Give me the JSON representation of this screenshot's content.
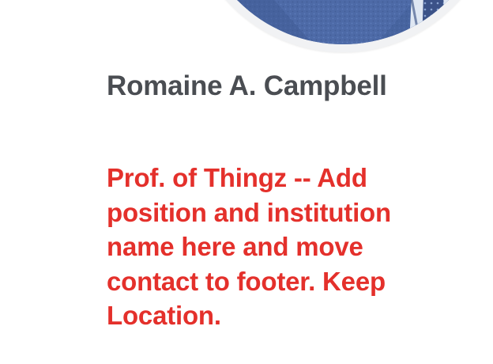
{
  "profile": {
    "name": "Romaine A. Campbell",
    "position": "Prof. of Thingz -- Add position and institution name here and move contact to footer. Keep Location.",
    "photo_icon": "profile-photo"
  },
  "colors": {
    "name_text": "#4a4d52",
    "position_text": "#e4302b",
    "photo_jacket": "#4a67a4",
    "background": "#ffffff"
  }
}
